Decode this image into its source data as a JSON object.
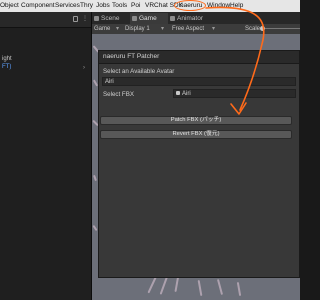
{
  "menubar": {
    "items": [
      "Object",
      "Component",
      "Services",
      "Thry",
      "Jobs",
      "Tools",
      "Poi",
      "VRChat SDK",
      "naeruru",
      "Window",
      "Help"
    ],
    "highlighted": "naeruru"
  },
  "left_panel": {
    "line1": "ight",
    "line2": "FT)"
  },
  "tabs": {
    "scene": "Scene",
    "game": "Game",
    "animator": "Animator"
  },
  "game_toolbar": {
    "mode": "Game",
    "display": "Display 1",
    "aspect": "Free Aspect",
    "scale_label": "Scale"
  },
  "patcher": {
    "title": "naeruru FT Patcher",
    "avatar_label": "Select an Available Avatar",
    "avatar_value": "Airi",
    "fbx_label": "Select FBX",
    "fbx_value": "Airi",
    "patch_button": "Patch FBX (パッチ)",
    "revert_button": "Revert FBX (復元)"
  },
  "colors": {
    "annotation": "#ff6a1a",
    "window_bg": "#383838",
    "scene_bg": "#6c6f79"
  }
}
